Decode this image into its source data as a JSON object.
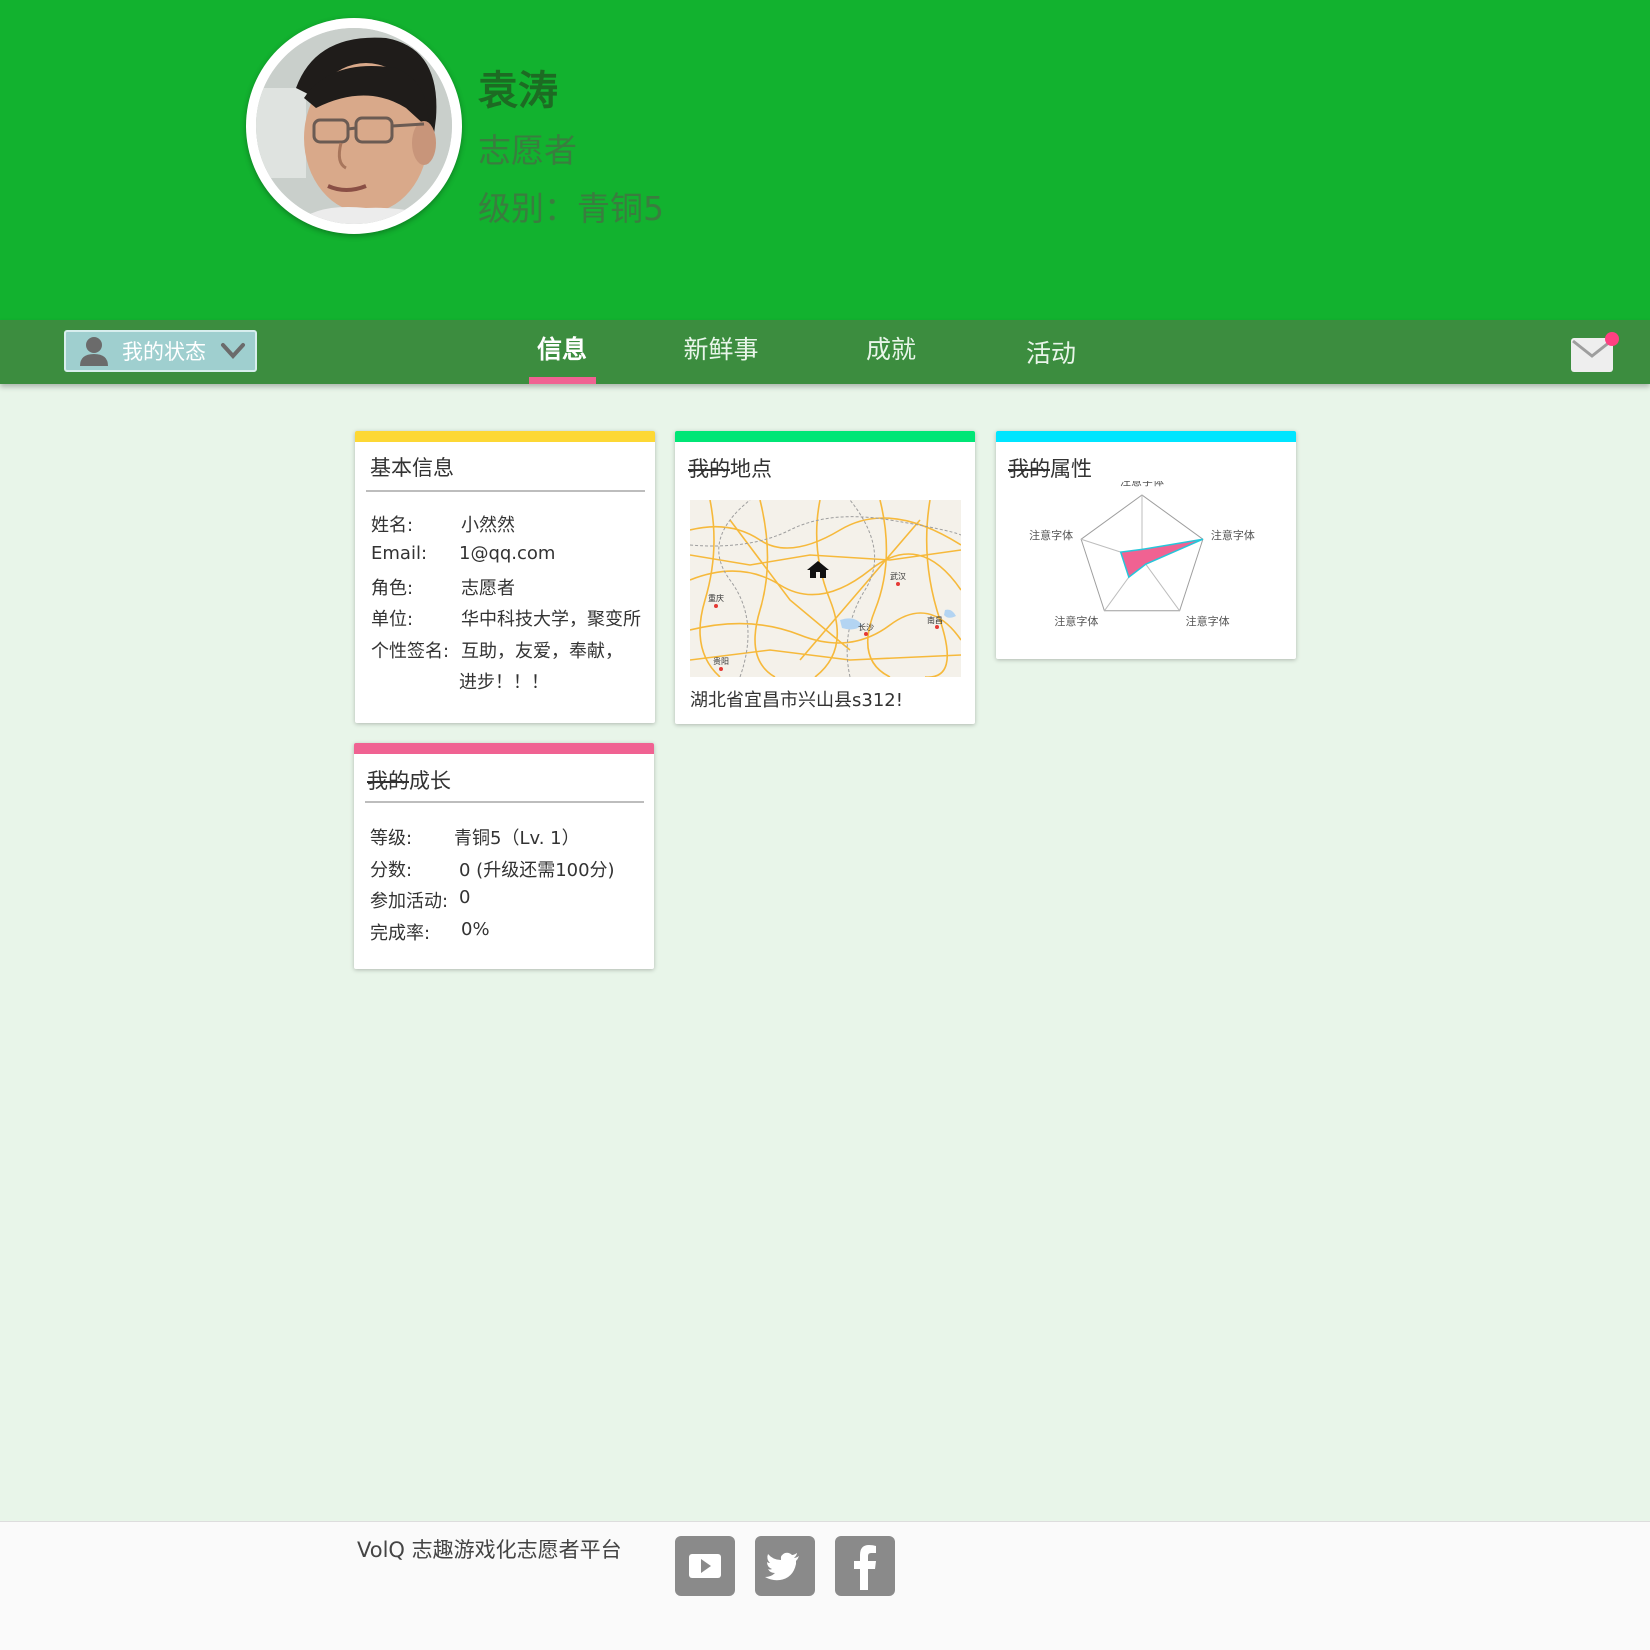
{
  "profile": {
    "name": "袁涛",
    "role": "志愿者",
    "level": "级别：青铜5"
  },
  "nav": {
    "status_label": "我的状态",
    "tabs": [
      {
        "label": "信息",
        "active": true
      },
      {
        "label": "新鲜事",
        "active": false
      },
      {
        "label": "成就",
        "active": false
      },
      {
        "label": "活动",
        "active": false
      }
    ]
  },
  "colors": {
    "header_green": "#12b22f",
    "nav_green": "#3c8d3f",
    "tab_accent": "#f06292",
    "card_basic": "#fdd835",
    "card_location": "#00e676",
    "card_attr": "#00e5ff",
    "card_growth": "#f06292",
    "notification": "#ff4081"
  },
  "icons": {
    "status": "person-icon",
    "dropdown": "chevron-down-icon",
    "mail": "mail-icon",
    "home": "home-icon",
    "youtube": "youtube-icon",
    "twitter": "twitter-icon",
    "facebook": "facebook-icon"
  },
  "basic_info": {
    "title": "基本信息",
    "rows": [
      {
        "label": "姓名:",
        "value": "小然然"
      },
      {
        "label": "Email:",
        "value": "1@qq.com"
      },
      {
        "label": "角色:",
        "value": "志愿者"
      },
      {
        "label": "单位:",
        "value": "华中科技大学，聚变所"
      },
      {
        "label": "个性签名:",
        "value": "互助，友爱，奉献，"
      },
      {
        "label": "",
        "value": "进步！！！"
      }
    ]
  },
  "location": {
    "title_strike": "我的",
    "title_rest": "地点",
    "address": "湖北省宜昌市兴山县s312!",
    "map_labels": [
      "武汉",
      "重庆",
      "长沙",
      "南昌",
      "贵阳"
    ]
  },
  "attributes": {
    "title_strike": "我的",
    "title_rest": "属性",
    "axis_labels": [
      "注意字体",
      "注意字体",
      "注意字体",
      "注意字体",
      "注意字体"
    ]
  },
  "growth": {
    "title_strike": "我的",
    "title_rest": "成长",
    "rows": [
      {
        "label": "等级:",
        "value": "青铜5（Lv. 1）"
      },
      {
        "label": "分数:",
        "value": "0 (升级还需100分)"
      },
      {
        "label": "参加活动:",
        "value": "0"
      },
      {
        "label": "完成率:",
        "value": "0%"
      }
    ]
  },
  "footer": {
    "text": "VolQ 志趣游戏化志愿者平台"
  },
  "chart_data": {
    "type": "radar",
    "categories": [
      "注意字体",
      "注意字体",
      "注意字体",
      "注意字体",
      "注意字体"
    ],
    "series": [
      {
        "values": [
          0.15,
          1.0,
          0.1,
          0.35,
          0.35
        ]
      }
    ],
    "ylim": [
      0,
      1
    ]
  }
}
